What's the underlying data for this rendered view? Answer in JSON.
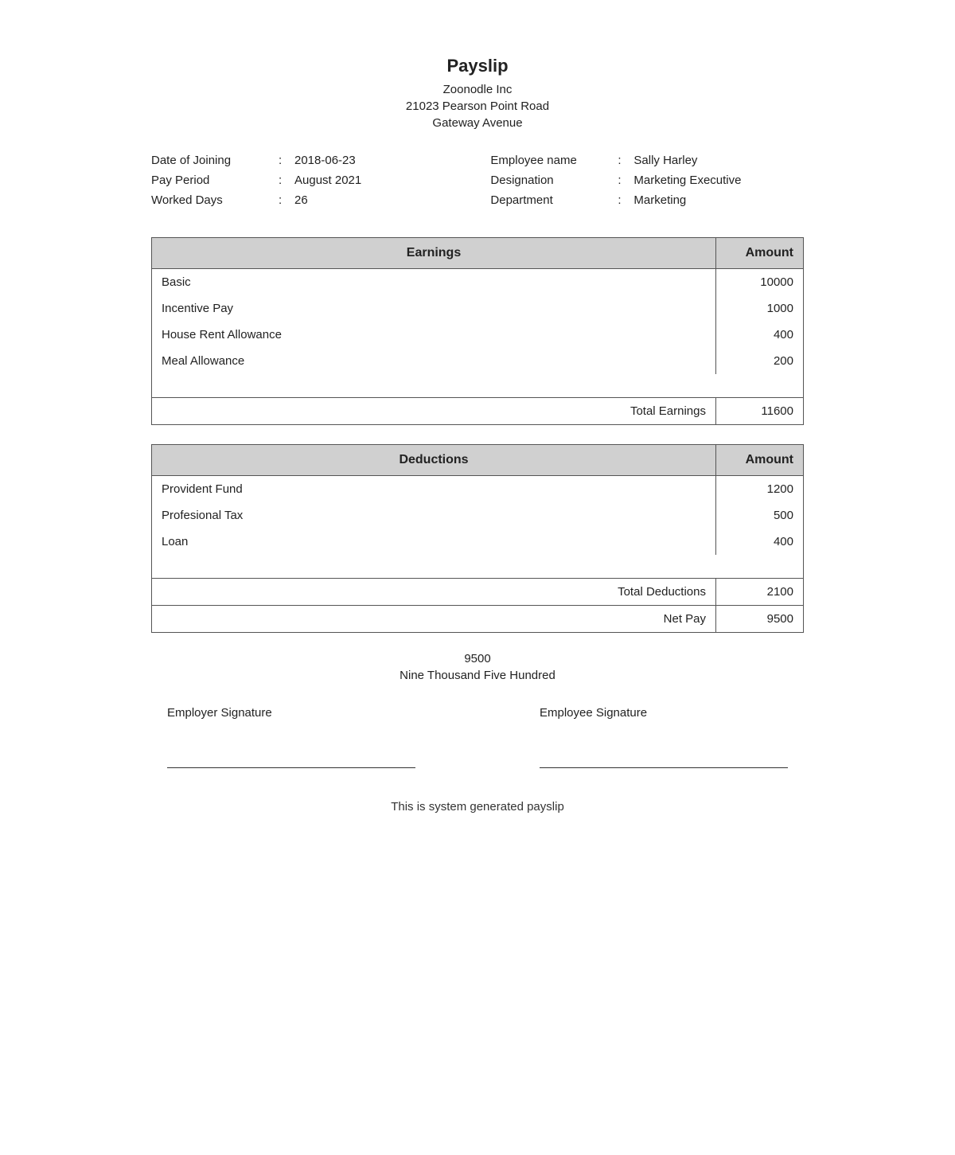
{
  "header": {
    "title": "Payslip",
    "company": "Zoonodle Inc",
    "address_line1": "21023 Pearson Point Road",
    "address_line2": "Gateway Avenue"
  },
  "info_left": {
    "fields": [
      {
        "label": "Date of Joining",
        "value": "2018-06-23"
      },
      {
        "label": "Pay Period",
        "value": "August 2021"
      },
      {
        "label": "Worked Days",
        "value": "26"
      }
    ]
  },
  "info_right": {
    "fields": [
      {
        "label": "Employee name",
        "value": "Sally Harley"
      },
      {
        "label": "Designation",
        "value": "Marketing Executive"
      },
      {
        "label": "Department",
        "value": "Marketing"
      }
    ]
  },
  "earnings": {
    "header_earnings": "Earnings",
    "header_amount": "Amount",
    "rows": [
      {
        "label": "Basic",
        "amount": "10000"
      },
      {
        "label": "Incentive Pay",
        "amount": "1000"
      },
      {
        "label": "House Rent Allowance",
        "amount": "400"
      },
      {
        "label": "Meal Allowance",
        "amount": "200"
      }
    ],
    "total_label": "Total Earnings",
    "total_amount": "11600"
  },
  "deductions": {
    "header_deductions": "Deductions",
    "header_amount": "Amount",
    "rows": [
      {
        "label": "Provident Fund",
        "amount": "1200"
      },
      {
        "label": "Profesional Tax",
        "amount": "500"
      },
      {
        "label": "Loan",
        "amount": "400"
      }
    ],
    "total_label": "Total Deductions",
    "total_amount": "2100",
    "net_pay_label": "Net Pay",
    "net_pay_amount": "9500"
  },
  "amount_words": {
    "numeric": "9500",
    "words": "Nine Thousand Five Hundred"
  },
  "signatures": {
    "employer": "Employer Signature",
    "employee": "Employee Signature"
  },
  "footer": {
    "text": "This is system generated payslip"
  }
}
